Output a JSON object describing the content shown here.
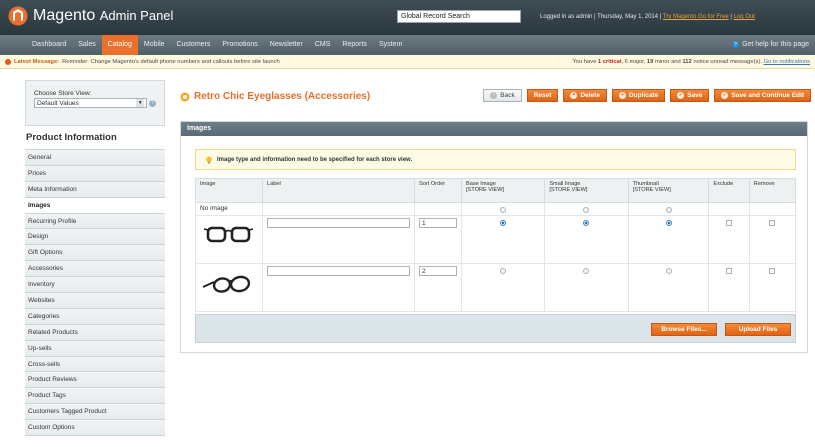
{
  "header": {
    "logo_text": "Magento",
    "logo_sub": "Admin Panel",
    "global_search_value": "Global Record Search",
    "user_prefix": "Logged in as admin",
    "date": "Thursday, May 1, 2014",
    "try_link": "Try Magento Go for Free",
    "logout": "Log Out",
    "separator": "|"
  },
  "nav": {
    "items": [
      "Dashboard",
      "Sales",
      "Catalog",
      "Mobile",
      "Customers",
      "Promotions",
      "Newsletter",
      "CMS",
      "Reports",
      "System"
    ],
    "active": "Catalog",
    "help": "Get help for this page"
  },
  "messages": {
    "latest_label": "Latest Message:",
    "latest_text": "Reminder: Change Magento's default phone numbers and callouts before site launch",
    "summary_prefix": "You have",
    "critical_count": "1 critical",
    "major": ", 6 major, ",
    "minor": "19",
    "minor_text": " minor and ",
    "notice": "112",
    "notice_text": " notice unread message(s).",
    "goto_link": "Go to notifications"
  },
  "sidebar": {
    "store_label": "Choose Store View:",
    "store_value": "Default Values",
    "section_title": "Product Information",
    "tabs": [
      "General",
      "Prices",
      "Meta Information",
      "Images",
      "Recurring Profile",
      "Design",
      "Gift Options",
      "Accessories",
      "Inventory",
      "Websites",
      "Categories",
      "Related Products",
      "Up-sells",
      "Cross-sells",
      "Product Reviews",
      "Product Tags",
      "Customers Tagged Product",
      "Custom Options"
    ],
    "active_tab": "Images"
  },
  "main": {
    "title": "Retro Chic Eyeglasses (Accessories)",
    "buttons": {
      "back": "Back",
      "reset": "Reset",
      "delete": "Delete",
      "duplicate": "Duplicate",
      "save": "Save",
      "save_continue": "Save and Continue Edit"
    },
    "section_title": "Images",
    "notice": "Image type and information need to be specified for each store view.",
    "table": {
      "headers": {
        "image": "Image",
        "label": "Label",
        "sort": "Sort Order",
        "base": "Base Image",
        "small": "Small Image",
        "thumb": "Thumbnail",
        "exclude": "Exclude",
        "remove": "Remove",
        "store_view": "[STORE VIEW]"
      },
      "no_image": "No image",
      "rows": [
        {
          "label": "",
          "sort": "1"
        },
        {
          "label": "",
          "sort": "2"
        }
      ]
    },
    "browse_button": "Browse Files...",
    "upload_button": "Upload Files"
  },
  "colors": {
    "accent": "#e46f2a",
    "header_bg": "#2f3b42",
    "nav_active": "#e9702d",
    "section_head": "#5f717b"
  }
}
